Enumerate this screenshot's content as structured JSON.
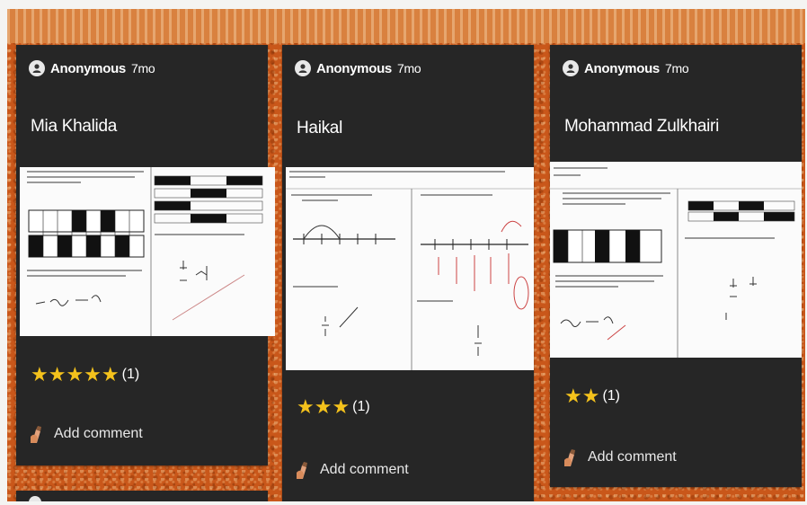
{
  "cards": [
    {
      "author": "Anonymous",
      "time": "7mo",
      "title": "Mia Khalida",
      "stars": "★★★★★",
      "rating_count": "(1)",
      "comment_label": "Add comment"
    },
    {
      "author": "Anonymous",
      "time": "7mo",
      "title": "Haikal",
      "stars": "★★★",
      "rating_count": "(1)",
      "comment_label": "Add comment"
    },
    {
      "author": "Anonymous",
      "time": "7mo",
      "title": "Mohammad Zulkhairi",
      "stars": "★★",
      "rating_count": "(1)",
      "comment_label": "Add comment"
    }
  ],
  "colors": {
    "board": "#c9571a",
    "card": "#262626",
    "star": "#f4c21c"
  },
  "icons": {
    "avatar": "anonymous-avatar-icon",
    "comment": "pencil-hand-icon"
  }
}
